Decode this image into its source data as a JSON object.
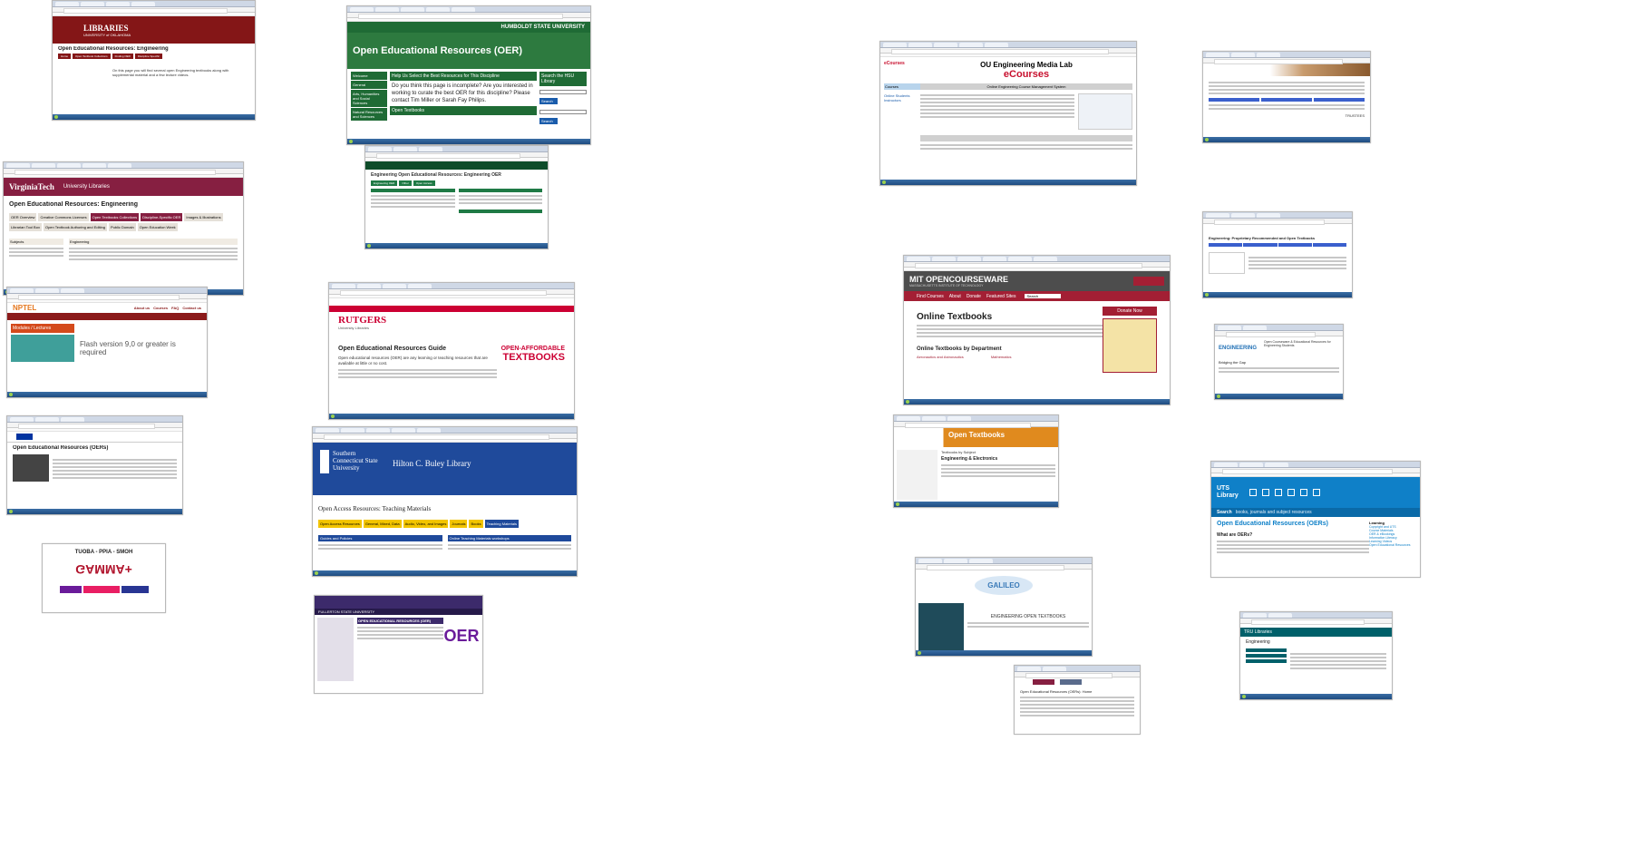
{
  "colors": {
    "ou_crimson": "#841617",
    "humboldt_green": "#1f6b35",
    "vt_maroon": "#861f41",
    "nptel_orange": "#e5771e",
    "rutgers_red": "#cc0033",
    "scsu_blue": "#1f4a9b",
    "mit_gray": "#4d4d4d",
    "mit_red": "#a31f34",
    "open_textbooks_orange": "#e08a1e",
    "uts_blue": "#0f80c8",
    "ecourses_red": "#c8102e"
  },
  "screenshots": [
    {
      "id": "ou",
      "header": "LIBRARIES",
      "subheader": "UNIVERSITY of OKLAHOMA",
      "title": "Open Educational Resources: Engineering",
      "snippet": "On this page you will find several open Engineering textbooks along with supplemental material and a few lecture videos."
    },
    {
      "id": "humboldt",
      "header": "HUMBOLDT STATE UNIVERSITY",
      "title": "Open Educational Resources (OER)",
      "sidebar": [
        "Welcome",
        "General",
        "Arts, Humanities and Social Sciences",
        "Natural Resources and Sciences"
      ],
      "help_heading": "Help Us Select the Best Resources for This Discipline",
      "help_text": "Do you think this page is incomplete? Are you interested in working to curate the best OER for this discipline? Please contact Tim Miller or Sarah Fay Philips.",
      "search_heading": "Search the HSU Library",
      "search_button": "Search",
      "footer_box": "Open Textbooks"
    },
    {
      "id": "ku",
      "title": "Engineering Open Educational Resources: Engineering OER"
    },
    {
      "id": "vt",
      "header": "VirginiaTech",
      "header_right": "University Libraries",
      "title": "Open Educational Resources: Engineering",
      "nav": [
        "OER Overview",
        "Creative Commons Licenses",
        "Open Textbooks Collections",
        "Discipline-Specific OER",
        "Images & Illustrations",
        "Librarian Tool Box",
        "Open Textbook Authoring and Editing",
        "Public Domain",
        "Open Education Week"
      ],
      "left_col": "Subjects",
      "right_col": "Engineering"
    },
    {
      "id": "nptel",
      "header": "NPTEL",
      "nav": [
        "About us",
        "Courses",
        "FAQ",
        "Contact us"
      ],
      "section": "Modules / Lectures",
      "message": "Flash version 9,0 or greater is required"
    },
    {
      "id": "rutgers",
      "header": "RUTGERS",
      "tagline": "University Libraries",
      "title": "Open Educational Resources Guide",
      "badge_line1": "OPEN-AFFORDABLE",
      "badge_line2": "TEXTBOOKS",
      "snippet": "Open educational resources (OER) are any learning or teaching resources that are available at little or no cost."
    },
    {
      "id": "scsu",
      "header": "Southern Connecticut State University",
      "library": "Hilton C. Buley Library",
      "title": "Open Access Resources: Teaching Materials",
      "tabs": [
        "Open Access Resources",
        "General, Mixed, Data",
        "Audio, Video, and Images",
        "Journals",
        "Books",
        "Teaching Materials"
      ],
      "box_left": "Guides and Policies",
      "box_right": "Online Teaching Materials workshops"
    },
    {
      "id": "mit",
      "header_left": "MIT OPENCOURSEWARE",
      "header_sub": "MASSACHUSETTS INSTITUTE OF TECHNOLOGY",
      "nav": [
        "Find Courses",
        "About",
        "Donate",
        "Featured Sites"
      ],
      "search_label": "Search",
      "title": "Online Textbooks",
      "donate": "Donate Now",
      "subtitle": "Online Textbooks by Department",
      "dept_left": "Aeronautics and Astronautics",
      "dept_right": "Mathematics"
    },
    {
      "id": "ecourses",
      "logo": "eCourses",
      "heading": "OU Engineering Media Lab",
      "subheading": "eCourses",
      "tagline": "Online Engineering Course Management System",
      "side_items": [
        "Courses",
        "Online Students",
        "Instructors"
      ]
    },
    {
      "id": "opentextbooks",
      "header": "Open Textbooks",
      "title": "Textbooks by Subject",
      "subtitle": "Engineering & Electronics"
    },
    {
      "id": "gamma",
      "banner": "GAMMA+",
      "top": "TUOBA - PPIA - SMOH"
    },
    {
      "id": "fullerton",
      "header": "FULLERTON STATE UNIVERSITY",
      "title": "OPEN EDUCATIONAL RESOURCES (OER)",
      "logo": "OER"
    },
    {
      "id": "galileo",
      "logo": "GALILEO",
      "title": "ENGINEERING OPEN TEXTBOOKS"
    },
    {
      "id": "vt2",
      "title": "Open Educational Resources (OERs): Home"
    },
    {
      "id": "uts",
      "logo": "UTS Library",
      "search": "Search",
      "search_placeholder": "books, journals and subject resources",
      "title": "Open Educational Resources (OERs)",
      "question": "What are OERs?",
      "side_heading": "Learning",
      "side_items": [
        "Copyright and UTS",
        "Course Materials",
        "OER & eBookings",
        "Information Literacy",
        "Learning Videos",
        "Open Educational Resources"
      ]
    },
    {
      "id": "engineering",
      "logo": "ENGINEERING",
      "heading": "Open Courseware & Educational Resources for Engineering Students",
      "item": "Bridging the Gap"
    },
    {
      "id": "tru",
      "header": "TRU Libraries",
      "title": "Engineering"
    },
    {
      "id": "purdue",
      "title": "Engineering: Proprietary Recommended and Open Textbooks"
    },
    {
      "id": "boise",
      "title": "Open Educational Resources (OERs)"
    },
    {
      "id": "indian",
      "label": "TRUSTEES"
    }
  ]
}
